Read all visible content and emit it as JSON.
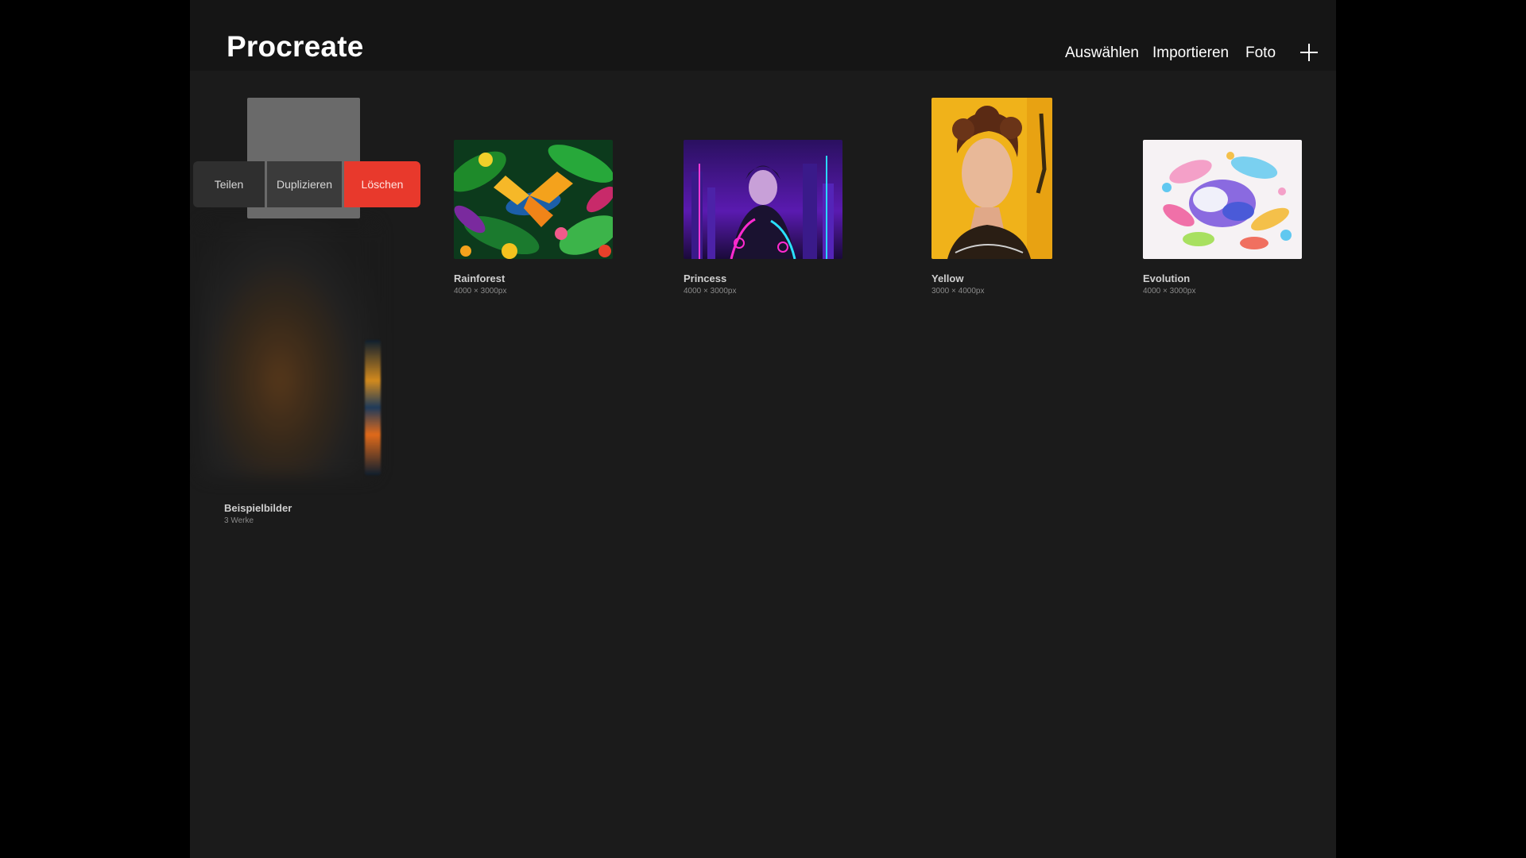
{
  "header": {
    "title": "Procreate",
    "actions": {
      "select": "Auswählen",
      "import": "Importieren",
      "photo": "Foto"
    }
  },
  "stack": {
    "title": "Beispielbilder",
    "subtitle": "3 Werke",
    "menu": {
      "share": "Teilen",
      "duplicate": "Duplizieren",
      "delete": "Löschen"
    }
  },
  "artworks": [
    {
      "title": "Rainforest",
      "size": "4000 × 3000px"
    },
    {
      "title": "Princess",
      "size": "4000 × 3000px"
    },
    {
      "title": "Yellow",
      "size": "3000 × 4000px"
    },
    {
      "title": "Evolution",
      "size": "4000 × 3000px"
    }
  ],
  "colors": {
    "background": "#1b1b1b",
    "header": "#151515",
    "delete": "#e8392c"
  },
  "icons": {
    "add": "plus-icon"
  }
}
